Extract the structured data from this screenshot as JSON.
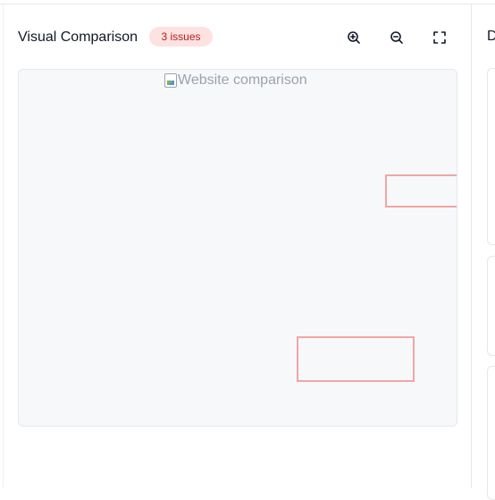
{
  "comparison_panel": {
    "title": "Visual Comparison",
    "issues_badge": "3 issues",
    "toolbar": {
      "zoom_in_icon": "zoom-in-icon",
      "zoom_out_icon": "zoom-out-icon",
      "fullscreen_icon": "fullscreen-icon"
    },
    "image_alt": "Website comparison",
    "issue_boxes": [
      {
        "label": "issue-1"
      },
      {
        "label": "issue-2"
      }
    ]
  },
  "details_panel": {
    "title": "D"
  },
  "colors": {
    "badge_bg": "#fde2e2",
    "badge_text": "#b91c1c",
    "issue_outline": "#f2a5a5",
    "canvas_bg": "#f7f8fa"
  }
}
